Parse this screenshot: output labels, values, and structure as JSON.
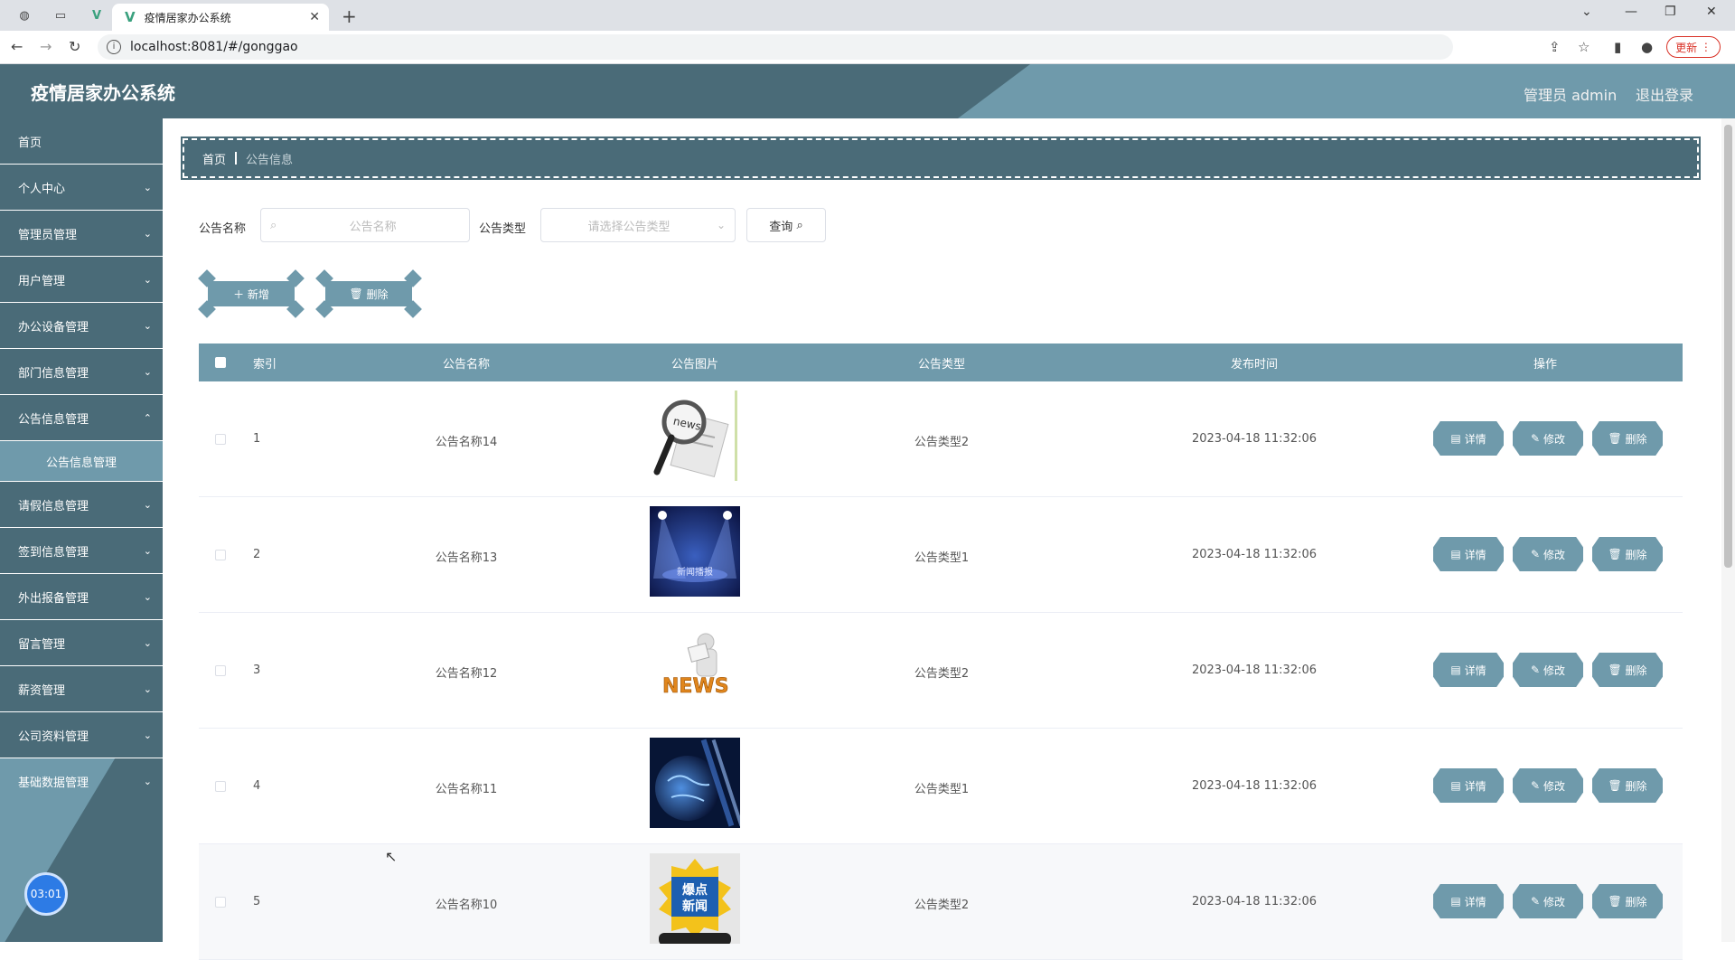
{
  "browser": {
    "tab_title": "疫情居家办公系统",
    "url": "localhost:8081/#/gonggao",
    "update_label": "更新"
  },
  "header": {
    "title": "疫情居家办公系统",
    "user": "管理员 admin",
    "logout": "退出登录"
  },
  "sidebar": {
    "items": [
      {
        "label": "首页"
      },
      {
        "label": "个人中心"
      },
      {
        "label": "管理员管理"
      },
      {
        "label": "用户管理"
      },
      {
        "label": "办公设备管理"
      },
      {
        "label": "部门信息管理"
      },
      {
        "label": "公告信息管理"
      },
      {
        "label": "请假信息管理"
      },
      {
        "label": "签到信息管理"
      },
      {
        "label": "外出报备管理"
      },
      {
        "label": "留言管理"
      },
      {
        "label": "薪资管理"
      },
      {
        "label": "公司资料管理"
      },
      {
        "label": "基础数据管理"
      }
    ],
    "sub_item": "公告信息管理",
    "timer": "03:01"
  },
  "breadcrumb": {
    "home": "首页",
    "current": "公告信息"
  },
  "search": {
    "name_label": "公告名称",
    "name_placeholder": "公告名称",
    "type_label": "公告类型",
    "type_placeholder": "请选择公告类型",
    "query_label": "查询"
  },
  "actions": {
    "add_label": "新增",
    "delete_label": "删除"
  },
  "table": {
    "headers": [
      "索引",
      "公告名称",
      "公告图片",
      "公告类型",
      "发布时间",
      "操作"
    ],
    "op_labels": [
      "详情",
      "修改",
      "删除"
    ],
    "rows": [
      {
        "index": "1",
        "name": "公告名称14",
        "type": "公告类型2",
        "time": "2023-04-18 11:32:06",
        "image_icon": "magnifier-news-image"
      },
      {
        "index": "2",
        "name": "公告名称13",
        "type": "公告类型1",
        "time": "2023-04-18 11:32:06",
        "image_icon": "spotlight-news-image"
      },
      {
        "index": "3",
        "name": "公告名称12",
        "type": "公告类型2",
        "time": "2023-04-18 11:32:06",
        "image_icon": "news-figure-image"
      },
      {
        "index": "4",
        "name": "公告名称11",
        "type": "公告类型1",
        "time": "2023-04-18 11:32:06",
        "image_icon": "globe-news-image"
      },
      {
        "index": "5",
        "name": "公告名称10",
        "type": "公告类型2",
        "time": "2023-04-18 11:32:06",
        "image_icon": "breaking-news-image"
      }
    ]
  },
  "thumb_text": {
    "news": "news",
    "spot": "新闻播报",
    "NEWS": "NEWS",
    "bao": "爆点",
    "xinwen": "新闻"
  },
  "colors": {
    "primary": "#4a6b78",
    "accent": "#6f9aab"
  }
}
